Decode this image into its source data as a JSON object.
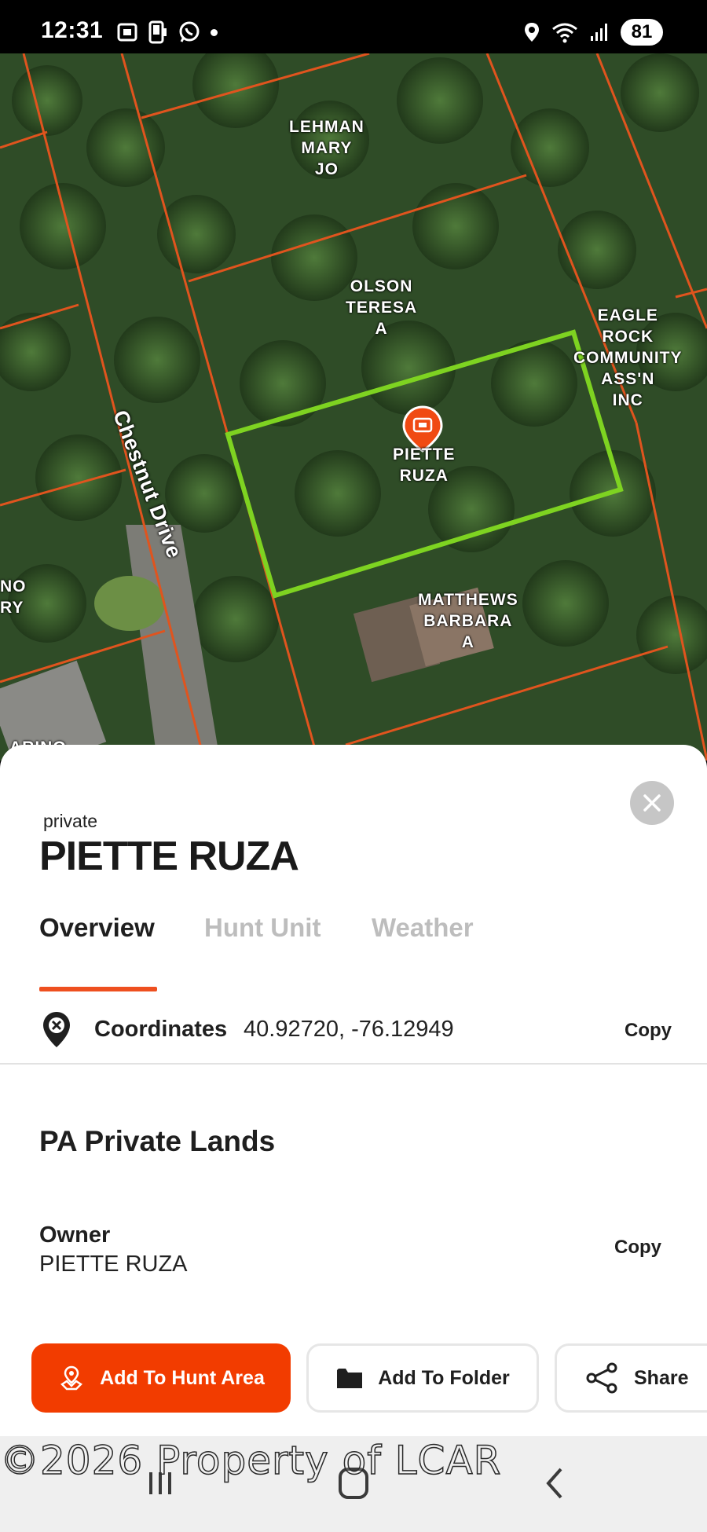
{
  "status_bar": {
    "time": "12:31",
    "battery": "81",
    "left_icons": [
      "screenshot-icon",
      "phone-icon",
      "whatsapp-icon",
      "notification-dot"
    ],
    "right_icons": [
      "location-icon",
      "wifi-icon",
      "signal-icon"
    ]
  },
  "map": {
    "parcel_labels": {
      "lehman": "LEHMAN\nMARY\nJO",
      "olson": "OLSON\nTERESA\nA",
      "eagle": "EAGLE\nROCK\nCOMMUNITY\nASS'N\nINC",
      "selected": "PIETTE\nRUZA",
      "matthews": "MATTHEWS\nBARBARA\nA",
      "partial_left": "NO\nRY",
      "partial_bottom": "ARINO"
    },
    "road_label": "Chestnut Drive",
    "colors": {
      "parcel_line": "#e0541e",
      "selected_outline": "#7ed321",
      "marker": "#f04a12"
    }
  },
  "sheet": {
    "ownership_type": "private",
    "title": "PIETTE RUZA",
    "tabs": [
      {
        "label": "Overview",
        "active": true
      },
      {
        "label": "Hunt Unit",
        "active": false
      },
      {
        "label": "Weather",
        "active": false
      }
    ],
    "coordinates": {
      "label": "Coordinates",
      "value": "40.92720, -76.12949",
      "copy_label": "Copy"
    },
    "section_title": "PA Private Lands",
    "owner": {
      "label": "Owner",
      "value": "PIETTE RUZA",
      "copy_label": "Copy"
    }
  },
  "actions": {
    "add_hunt_area": "Add To Hunt Area",
    "add_folder": "Add To Folder",
    "share": "Share"
  },
  "watermark": "©2026 Property of LCAR",
  "accent_color": "#f23c00"
}
